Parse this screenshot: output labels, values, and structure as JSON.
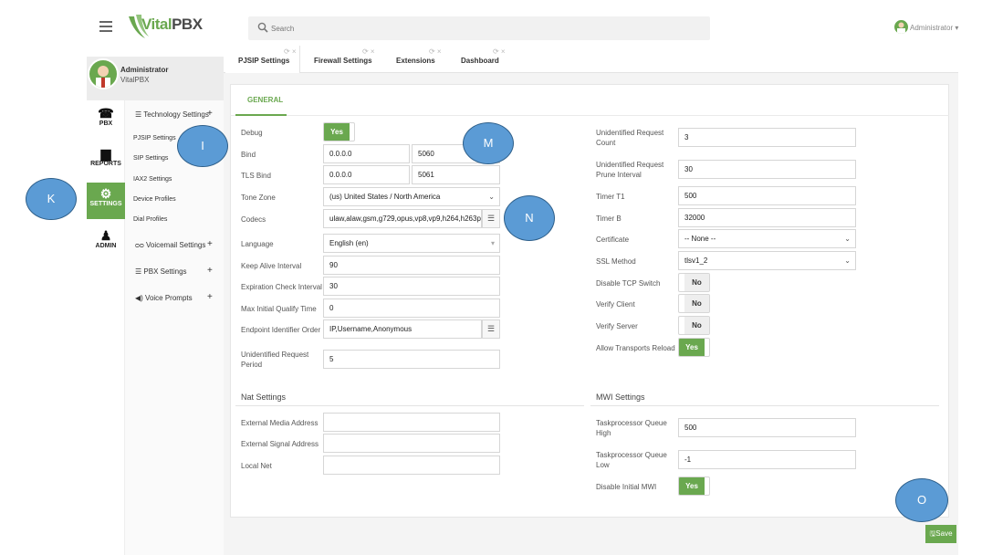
{
  "header": {
    "logo_text_v": "Vital",
    "logo_text_p": "PBX",
    "search_placeholder": "Search",
    "user_label": "Administrator ▾"
  },
  "profile": {
    "name": "Administrator",
    "sub": "VitalPBX"
  },
  "nav": [
    {
      "label": "PBX",
      "icon": "phone-icon"
    },
    {
      "label": "REPORTS",
      "icon": "document-icon"
    },
    {
      "label": "SETTINGS",
      "icon": "gears-icon"
    },
    {
      "label": "ADMIN",
      "icon": "admin-icon"
    }
  ],
  "submenu": {
    "technology": "Technology Settings",
    "pjsip": "PJSIP Settings",
    "sip": "SIP Settings",
    "iax2": "IAX2 Settings",
    "device_profiles": "Device Profiles",
    "dial_profiles": "Dial Profiles",
    "voicemail": "Voicemail Settings",
    "pbx": "PBX Settings",
    "voice_prompts": "Voice Prompts",
    "plus": "+"
  },
  "tabs": [
    {
      "label": "PJSIP Settings"
    },
    {
      "label": "Firewall Settings"
    },
    {
      "label": "Extensions"
    },
    {
      "label": "Dashboard"
    }
  ],
  "tab_controls": "⟳ ×",
  "general_tab": "GENERAL",
  "left_fields": {
    "debug": {
      "label": "Debug",
      "value": "Yes"
    },
    "bind": {
      "label": "Bind",
      "ip": "0.0.0.0",
      "port": "5060"
    },
    "tls_bind": {
      "label": "TLS Bind",
      "ip": "0.0.0.0",
      "port": "5061"
    },
    "tone_zone": {
      "label": "Tone Zone",
      "value": "(us) United States / North America"
    },
    "codecs": {
      "label": "Codecs",
      "value": "ulaw,alaw,gsm,g729,opus,vp8,vp9,h264,h263p..."
    },
    "language": {
      "label": "Language",
      "value": "English (en)"
    },
    "keep_alive": {
      "label": "Keep Alive Interval",
      "value": "90"
    },
    "expiration_check": {
      "label": "Expiration Check Interval",
      "value": "30"
    },
    "max_initial_qualify": {
      "label": "Max Initial Qualify Time",
      "value": "0"
    },
    "endpoint_identifier": {
      "label": "Endpoint Identifier Order",
      "value": "IP,Username,Anonymous"
    },
    "unidentified_period": {
      "label_1": "Unidentified Request",
      "label_2": "Period",
      "value": "5"
    }
  },
  "right_fields": {
    "unidentified_count": {
      "label_1": "Unidentified Request",
      "label_2": "Count",
      "value": "3"
    },
    "unidentified_prune": {
      "label_1": "Unidentified Request",
      "label_2": "Prune Interval",
      "value": "30"
    },
    "timer_t1": {
      "label": "Timer T1",
      "value": "500"
    },
    "timer_b": {
      "label": "Timer B",
      "value": "32000"
    },
    "certificate": {
      "label": "Certificate",
      "value": "-- None --"
    },
    "ssl_method": {
      "label": "SSL Method",
      "value": "tlsv1_2"
    },
    "disable_tcp": {
      "label": "Disable TCP Switch",
      "value": "No"
    },
    "verify_client": {
      "label": "Verify Client",
      "value": "No"
    },
    "verify_server": {
      "label": "Verify Server",
      "value": "No"
    },
    "allow_transports": {
      "label": "Allow Transports Reload",
      "value": "Yes"
    }
  },
  "nat": {
    "title": "Nat Settings",
    "external_media": "External Media Address",
    "external_signal": "External Signal Address",
    "local_net": "Local Net"
  },
  "mwi": {
    "title": "MWI Settings",
    "queue_high": {
      "label_1": "Taskprocessor Queue",
      "label_2": "High",
      "value": "500"
    },
    "queue_low": {
      "label_1": "Taskprocessor Queue",
      "label_2": "Low",
      "value": "-1"
    },
    "disable_initial": {
      "label": "Disable Initial MWI",
      "value": "Yes"
    }
  },
  "save_label": "Save",
  "callouts": {
    "i": "I",
    "k": "K",
    "m": "M",
    "n": "N",
    "o": "O"
  },
  "colors": {
    "accent": "#6aa84f",
    "callout": "#5b9bd5"
  }
}
